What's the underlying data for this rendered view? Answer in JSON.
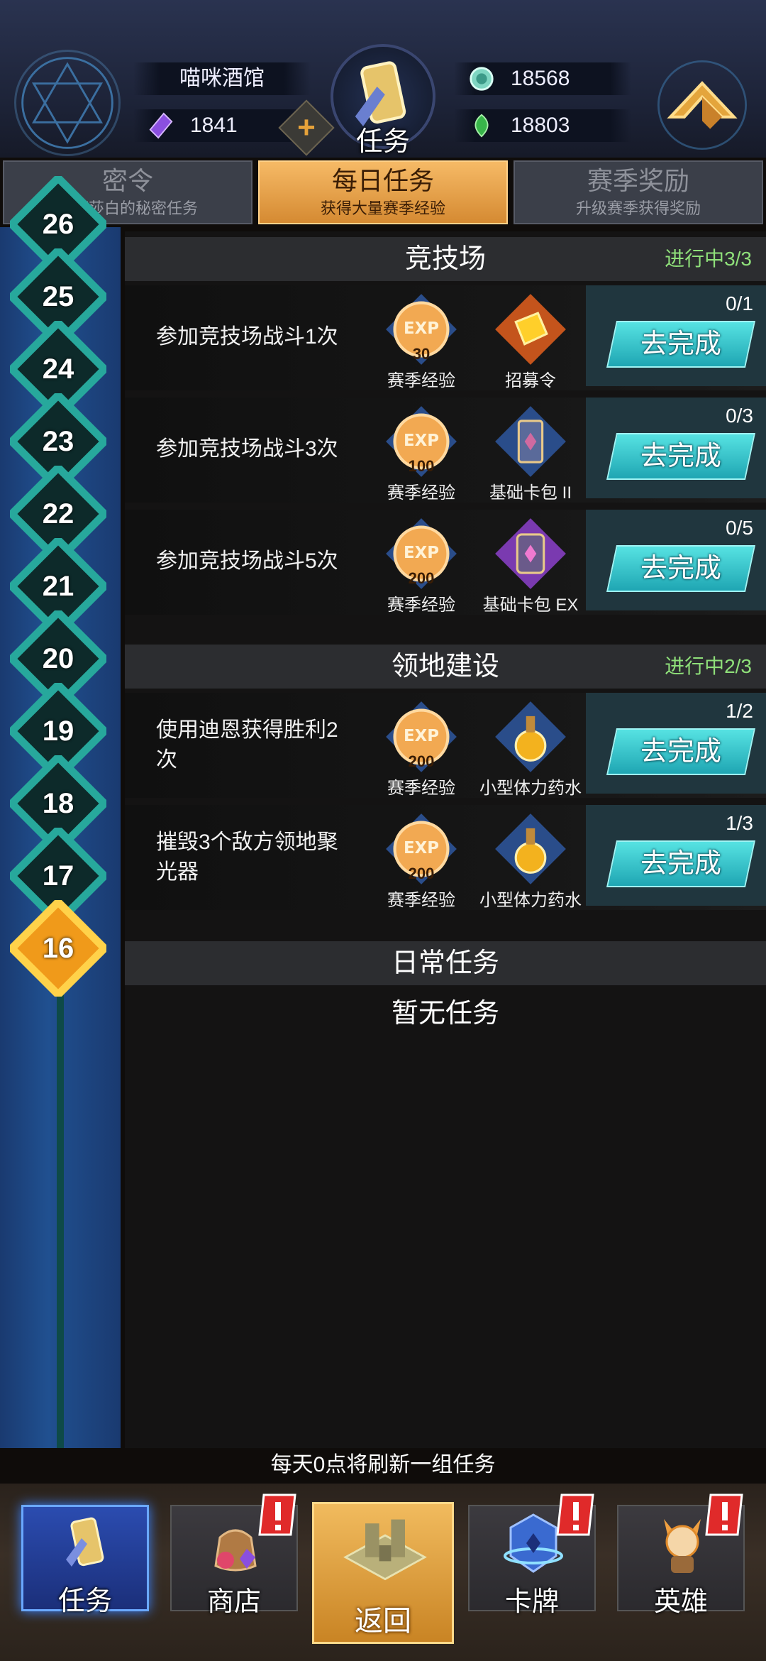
{
  "header": {
    "tavern_name": "喵咪酒馆",
    "title": "任务",
    "resources": {
      "crystal": "1841",
      "coin": "18568",
      "gem": "18803"
    },
    "plus_label": "+"
  },
  "tabs": [
    {
      "title": "密令",
      "subtitle": "伊丽莎白的秘密任务",
      "active": false
    },
    {
      "title": "每日任务",
      "subtitle": "获得大量赛季经验",
      "active": true
    },
    {
      "title": "赛季奖励",
      "subtitle": "升级赛季获得奖励",
      "active": false
    }
  ],
  "levels": [
    "26",
    "25",
    "24",
    "23",
    "22",
    "21",
    "20",
    "19",
    "18",
    "17",
    "16"
  ],
  "current_level": "16",
  "sections": {
    "arena": {
      "title": "竞技场",
      "progress": "进行中3/3",
      "quests": [
        {
          "desc": "参加竞技场战斗1次",
          "exp": "30",
          "exp_label": "赛季经验",
          "item_label": "招募令",
          "count": "0/1",
          "button": "去完成"
        },
        {
          "desc": "参加竞技场战斗3次",
          "exp": "100",
          "exp_label": "赛季经验",
          "item_label": "基础卡包 II",
          "count": "0/3",
          "button": "去完成"
        },
        {
          "desc": "参加竞技场战斗5次",
          "exp": "200",
          "exp_label": "赛季经验",
          "item_label": "基础卡包 EX",
          "count": "0/5",
          "button": "去完成"
        }
      ]
    },
    "territory": {
      "title": "领地建设",
      "progress": "进行中2/3",
      "quests": [
        {
          "desc": "使用迪恩获得胜利2次",
          "exp": "200",
          "exp_label": "赛季经验",
          "item_label": "小型体力药水",
          "count": "1/2",
          "button": "去完成"
        },
        {
          "desc": "摧毁3个敌方领地聚光器",
          "exp": "200",
          "exp_label": "赛季经验",
          "item_label": "小型体力药水",
          "count": "1/3",
          "button": "去完成"
        }
      ]
    },
    "daily": {
      "title": "日常任务",
      "empty": "暂无任务"
    }
  },
  "refresh_notice": "每天0点将刷新一组任务",
  "nav": {
    "quests": "任务",
    "shop": "商店",
    "back": "返回",
    "cards": "卡牌",
    "heroes": "英雄"
  },
  "exp_icon_text": "EXP",
  "colors": {
    "accent_orange": "#e9a445",
    "progress_green": "#8fe07a",
    "button_teal": "#35c6cc",
    "alert_red": "#e02a2a"
  }
}
